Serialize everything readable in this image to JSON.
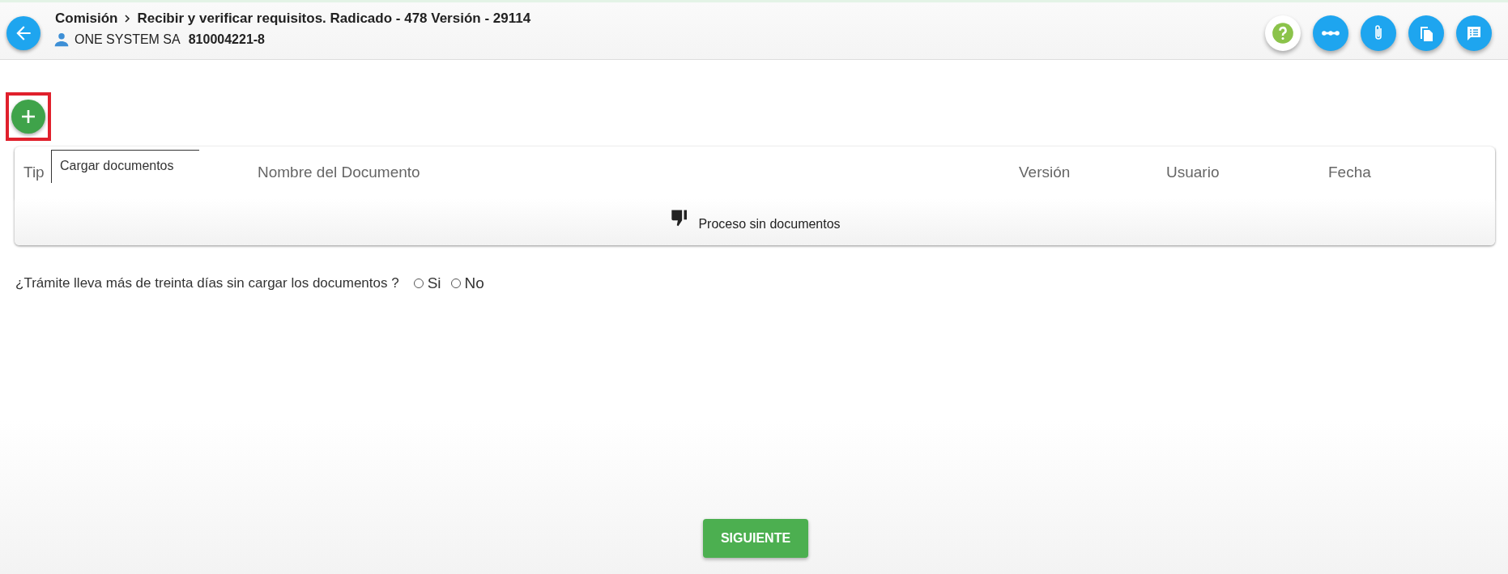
{
  "header": {
    "breadcrumb": [
      "Comisión",
      "Recibir y verificar requisitos. Radicado - 478 Versión - 29114"
    ],
    "company": "ONE SYSTEM SA",
    "nit": "810004221-8",
    "actions": [
      {
        "kind": "help"
      },
      {
        "kind": "flow"
      },
      {
        "kind": "attach"
      },
      {
        "kind": "copy"
      },
      {
        "kind": "comment"
      }
    ]
  },
  "add_button": {
    "highlighted": true,
    "tooltip": "Cargar documentos"
  },
  "table": {
    "columns": [
      "Tip",
      "Nombre del Documento",
      "Versión",
      "Usuario",
      "Fecha"
    ],
    "empty_message": "Proceso sin documentos"
  },
  "question": {
    "text": "¿Trámite lleva más de treinta días sin cargar los documentos ?",
    "options": [
      {
        "label": "Si",
        "selected": false
      },
      {
        "label": "No",
        "selected": false
      }
    ]
  },
  "next_button": "SIGUIENTE"
}
